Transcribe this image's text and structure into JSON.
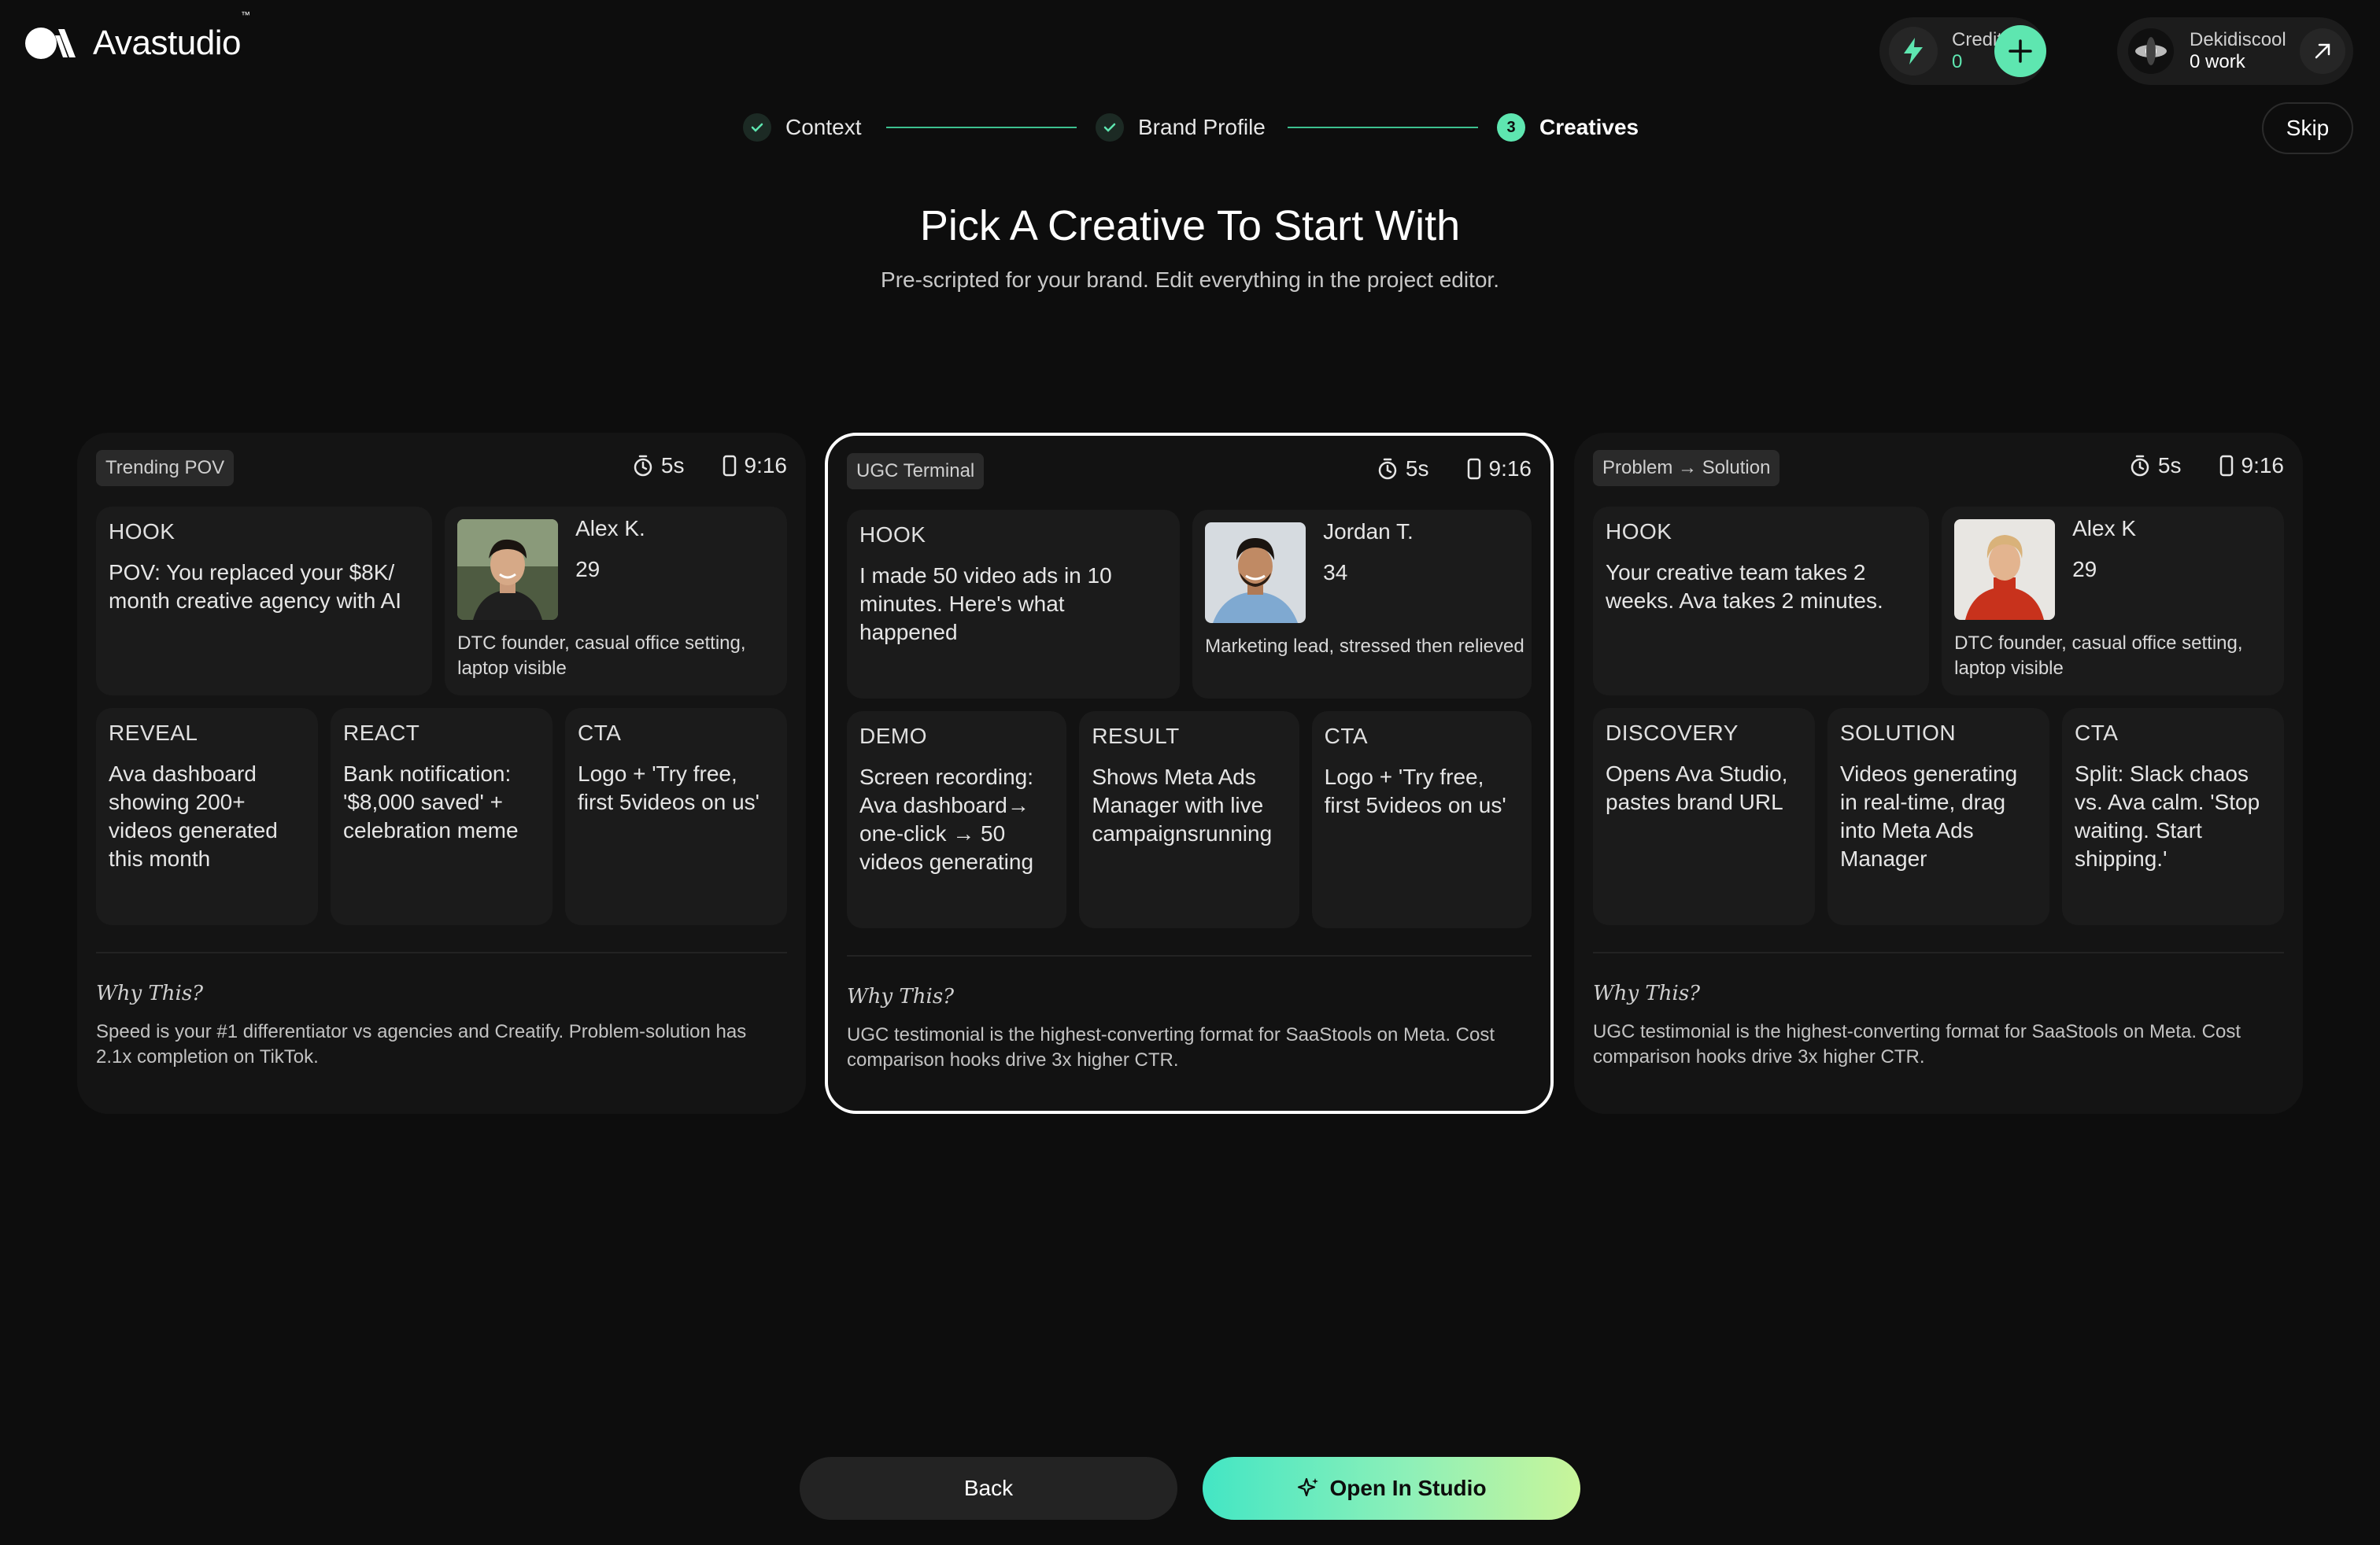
{
  "app": {
    "name": "Avastudio",
    "tm": "™"
  },
  "header": {
    "credits_label": "Credits",
    "credits_value": "0",
    "user_name": "Dekidiscool",
    "user_work": "0 work",
    "accent": "#5ee6b0"
  },
  "stepper": {
    "steps": [
      {
        "label": "Context",
        "state": "done"
      },
      {
        "label": "Brand Profile",
        "state": "done"
      },
      {
        "label": "Creatives",
        "number": "3",
        "state": "active"
      }
    ],
    "skip_label": "Skip"
  },
  "page": {
    "title": "Pick A Creative To Start With",
    "subtitle": "Pre-scripted for your brand. Edit everything in the project editor."
  },
  "cards": [
    {
      "tag": "Trending POV",
      "duration": "5s",
      "ratio": "9:16",
      "hook_label": "HOOK",
      "hook_text": "POV: You replaced your $8K/ month creative agency with AI",
      "person_name": "Alex K.",
      "person_age": "29",
      "person_desc": "DTC founder, casual office setting, laptop visible",
      "beats": [
        {
          "label": "REVEAL",
          "text": "Ava dashboard showing 200+ videos generated this month"
        },
        {
          "label": "REACT",
          "text": "Bank notification: '$8,000 saved' + celebration meme"
        },
        {
          "label": "CTA",
          "text": "Logo + 'Try free, first 5videos on us'"
        }
      ],
      "why_label": "Why This?",
      "why_text": "Speed is your #1 differentiator vs agencies and Creatify. Problem-solution has 2.1x completion on TikTok.",
      "selected": false
    },
    {
      "tag": "UGC Terminal",
      "duration": "5s",
      "ratio": "9:16",
      "hook_label": "HOOK",
      "hook_text": "I made 50 video ads in 10 minutes. Here's what happened",
      "person_name": "Jordan T.",
      "person_age": "34",
      "person_desc": "Marketing lead, stressed then relieved",
      "beats": [
        {
          "label": "DEMO",
          "text": "Screen recording: Ava dashboard→ one-click → 50 videos generating"
        },
        {
          "label": "RESULT",
          "text": "Shows Meta Ads Manager with live campaignsrunning"
        },
        {
          "label": "CTA",
          "text": "Logo + 'Try free, first 5videos on us'"
        }
      ],
      "why_label": "Why This?",
      "why_text": "UGC testimonial is the highest-converting format for SaaStools on Meta. Cost comparison hooks drive 3x higher CTR.",
      "selected": true
    },
    {
      "tag": "Problem → Solution",
      "duration": "5s",
      "ratio": "9:16",
      "hook_label": "HOOK",
      "hook_text": "Your creative team takes 2 weeks. Ava takes 2 minutes.",
      "person_name": "Alex K",
      "person_age": "29",
      "person_desc": "DTC founder, casual office setting, laptop visible",
      "beats": [
        {
          "label": "DISCOVERY",
          "text": "Opens Ava Studio, pastes brand URL"
        },
        {
          "label": "SOLUTION",
          "text": "Videos generating in real-time, drag into Meta Ads Manager"
        },
        {
          "label": "CTA",
          "text": "Split: Slack chaos vs. Ava calm. 'Stop waiting. Start shipping.'"
        }
      ],
      "why_label": "Why This?",
      "why_text": "UGC testimonial is the highest-converting format for SaaStools on Meta. Cost comparison hooks drive 3x higher CTR.",
      "selected": false
    }
  ],
  "footer": {
    "back_label": "Back",
    "open_label": "Open In Studio"
  }
}
